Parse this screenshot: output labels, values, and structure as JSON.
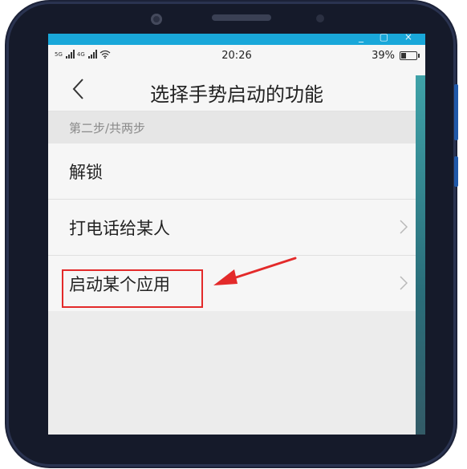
{
  "window_controls": "_ ▢ ×",
  "status_bar": {
    "signal_tag_1": "5G",
    "signal_tag_2": "4G",
    "time": "20:26",
    "battery": "39%",
    "battery_level": 0.39
  },
  "header": {
    "title": "选择手势启动的功能"
  },
  "section": {
    "label": "第二步/共两步"
  },
  "list": {
    "items": [
      {
        "label": "解锁",
        "has_chevron": false
      },
      {
        "label": "打电话给某人",
        "has_chevron": true
      },
      {
        "label": "启动某个应用",
        "has_chevron": true
      }
    ]
  },
  "annotation": {
    "highlight_color": "#e32a2a"
  },
  "icons": {
    "back": "back-chevron-icon",
    "chevron": "chevron-right-icon",
    "wifi": "wifi-icon",
    "battery": "battery-icon",
    "signal": "signal-icon"
  },
  "colors": {
    "accent_strip": "#19a7d9",
    "background": "#ececec",
    "list_bg": "#f6f6f6"
  }
}
